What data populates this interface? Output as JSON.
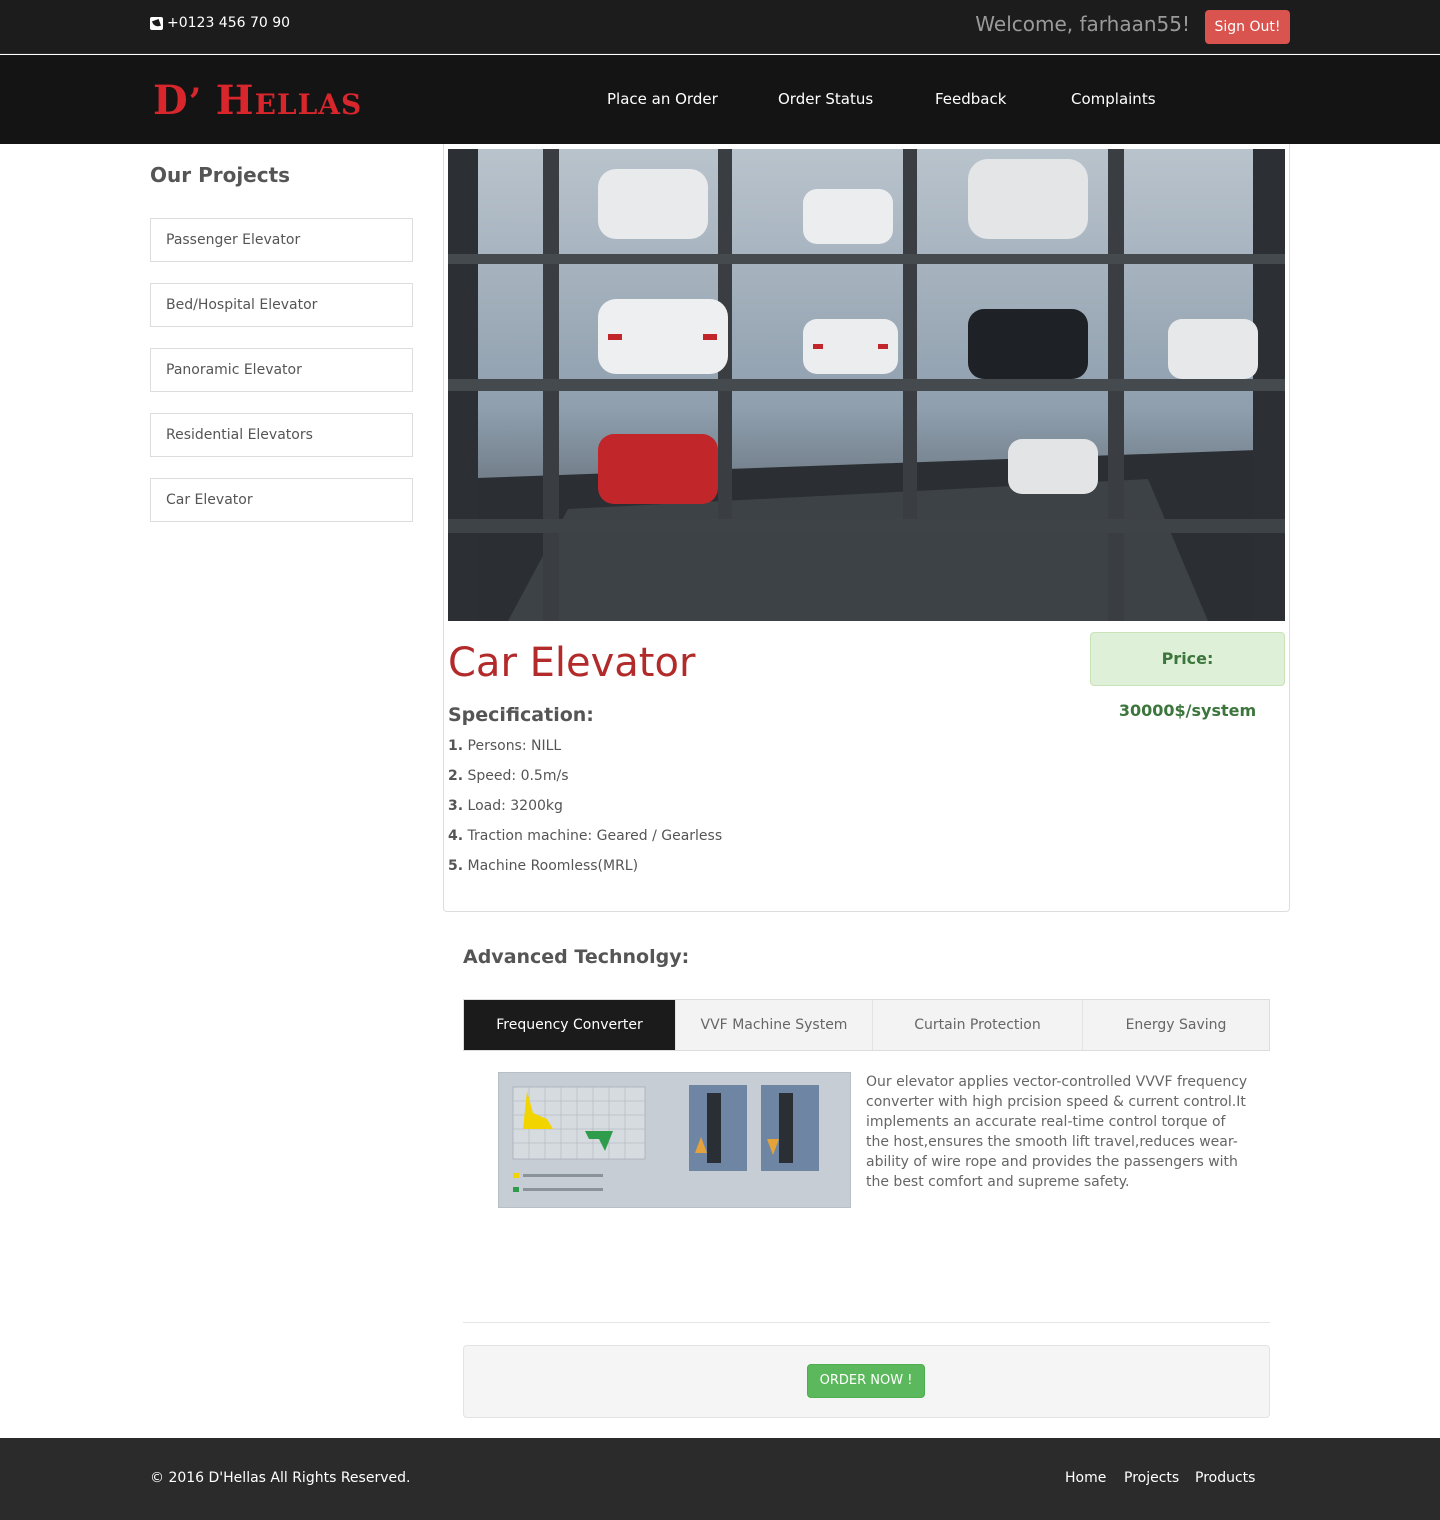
{
  "topbar": {
    "phone": "+0123 456 70 90",
    "welcome": "Welcome, farhaan55!",
    "signout": "Sign Out!"
  },
  "navbar": {
    "logo_d": "D",
    "logo_apos": "’",
    "logo_h": "H",
    "logo_rest": "ELLAS",
    "links": [
      "Place an Order",
      "Order Status",
      "Feedback",
      "Complaints"
    ]
  },
  "sidebar": {
    "title": "Our Projects",
    "items": [
      "Passenger Elevator",
      "Bed/Hospital Elevator",
      "Panoramic Elevator",
      "Residential Elevators",
      "Car Elevator"
    ]
  },
  "product": {
    "title": "Car Elevator",
    "price": "Price: 30000$/system",
    "spec_heading": "Specification:",
    "specs": [
      {
        "num": "1.",
        "text": "Persons: NILL"
      },
      {
        "num": "2.",
        "text": "Speed: 0.5m/s"
      },
      {
        "num": "3.",
        "text": "Load: 3200kg"
      },
      {
        "num": "4.",
        "text": "Traction machine: Geared / Gearless"
      },
      {
        "num": "5.",
        "text": "Machine Roomless(MRL)"
      }
    ]
  },
  "advanced": {
    "heading": "Advanced Technolgy:",
    "tabs": [
      "Frequency Converter",
      "VVF Machine System",
      "Curtain Protection",
      "Energy Saving"
    ],
    "active_tab": 0,
    "description": "Our elevator applies vector-controlled VVVF frequency converter with high prcision speed & current control.It implements an accurate real-time control torque of the host,ensures the smooth lift travel,reduces wear-ability of wire rope and provides the passengers with the best comfort and supreme safety."
  },
  "order": {
    "button": "ORDER NOW !"
  },
  "footer": {
    "copyright": "© 2016 D'Hellas All Rights Reserved.",
    "links": [
      "Home",
      "Projects",
      "Products"
    ]
  },
  "colors": {
    "accent_red": "#d9262c",
    "title_red": "#b22a2a",
    "signout": "#d9534f",
    "order_green": "#5cb85c",
    "price_bg": "#dff0d8"
  }
}
